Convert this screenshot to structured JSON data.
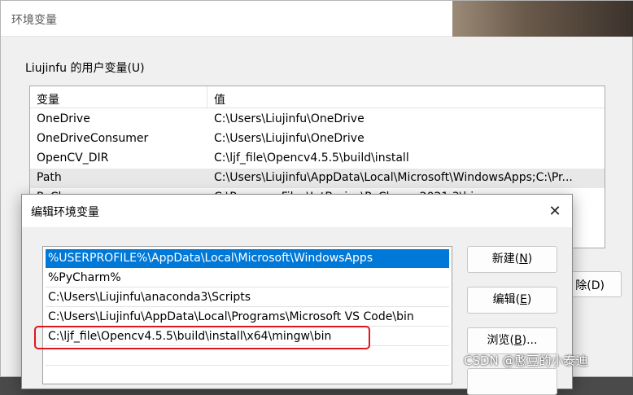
{
  "bg_window": {
    "title": "环境变量",
    "group_label": "Liujinfu 的用户变量(U)",
    "columns": {
      "name": "变量",
      "value": "值"
    },
    "rows": [
      {
        "name": "OneDrive",
        "value": "C:\\Users\\Liujinfu\\OneDrive"
      },
      {
        "name": "OneDriveConsumer",
        "value": "C:\\Users\\Liujinfu\\OneDrive"
      },
      {
        "name": "OpenCV_DIR",
        "value": "C:\\ljf_file\\Opencv4.5.5\\build\\install"
      },
      {
        "name": "Path",
        "value": "C:\\Users\\Liujinfu\\AppData\\Local\\Microsoft\\WindowsApps;C:\\Pr..."
      },
      {
        "name": "PyCharm",
        "value": "C:\\Program Files\\JetBrains\\PyCharm 2021.3\\bin"
      }
    ],
    "delete_button": "除(D)"
  },
  "edit_dialog": {
    "title": "编辑环境变量",
    "close_glyph": "✕",
    "entries": [
      "%USERPROFILE%\\AppData\\Local\\Microsoft\\WindowsApps",
      "%PyCharm%",
      "C:\\Users\\Liujinfu\\anaconda3\\Scripts",
      "C:\\Users\\Liujinfu\\AppData\\Local\\Programs\\Microsoft VS Code\\bin",
      "C:\\ljf_file\\Opencv4.5.5\\build\\install\\x64\\mingw\\bin"
    ],
    "buttons": {
      "new": {
        "text": "新建(",
        "key": "N",
        "end": ")"
      },
      "edit": {
        "text": "编辑(",
        "key": "E",
        "end": ")"
      },
      "browse": {
        "text": "浏览(",
        "key": "B",
        "end": ")..."
      }
    }
  },
  "watermark": "CSDN @憨豆的小泰迪",
  "colors": {
    "selection": "#0078d7",
    "highlight_border": "#e0161c"
  }
}
